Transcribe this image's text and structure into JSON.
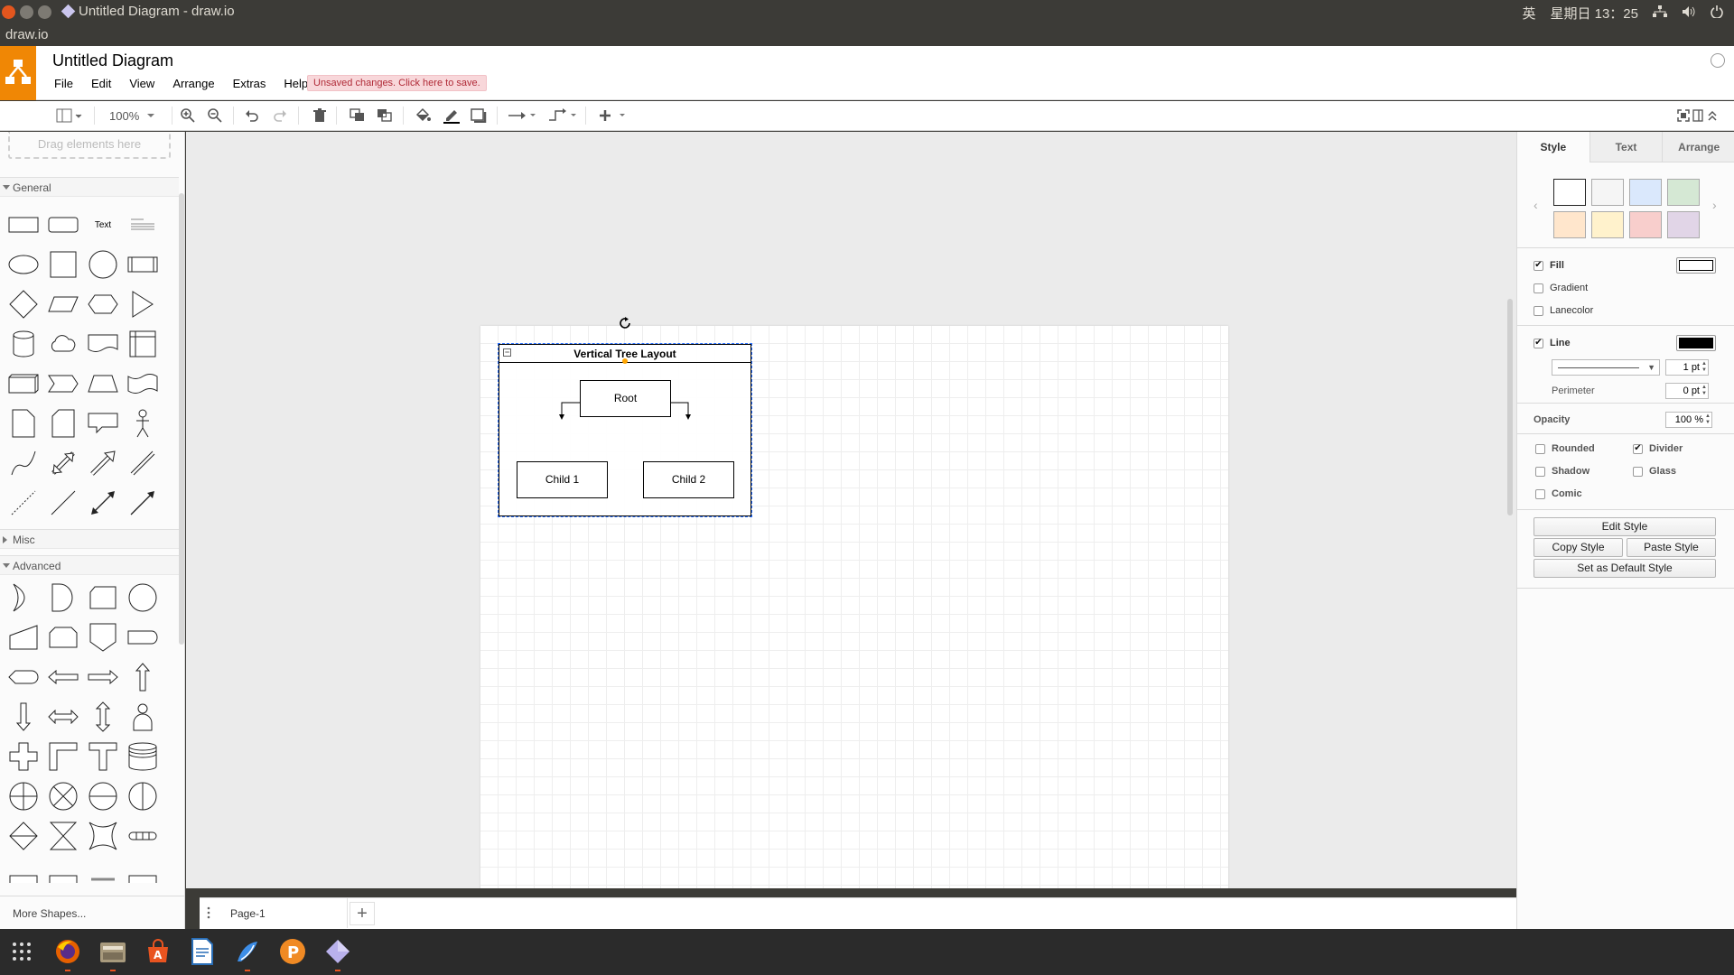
{
  "os": {
    "window_title": "Untitled Diagram - draw.io",
    "app_name": "draw.io",
    "tray": {
      "ime": "英",
      "clock": "星期日 13：25"
    }
  },
  "header": {
    "doc_title": "Untitled Diagram",
    "menu": [
      "File",
      "Edit",
      "View",
      "Arrange",
      "Extras",
      "Help"
    ],
    "unsaved": "Unsaved changes. Click here to save."
  },
  "toolbar": {
    "zoom": "100%"
  },
  "sidebar": {
    "drop_hint": "Drag elements here",
    "sections": {
      "general": "General",
      "misc": "Misc",
      "advanced": "Advanced"
    },
    "text_shape_label": "Text",
    "more_shapes": "More Shapes..."
  },
  "diagram": {
    "container_title": "Vertical Tree Layout",
    "root": "Root",
    "child1": "Child 1",
    "child2": "Child 2"
  },
  "pages": {
    "current": "Page-1"
  },
  "format_panel": {
    "tabs": [
      "Style",
      "Text",
      "Arrange"
    ],
    "swatches": [
      "#ffffff",
      "#f5f5f5",
      "#dae8fc",
      "#d5e8d4",
      "#ffe6cc",
      "#fff2cc",
      "#f8cecc",
      "#e1d5e7"
    ],
    "fill_label": "Fill",
    "fill_color": "#ffffff",
    "gradient_label": "Gradient",
    "lanecolor_label": "Lanecolor",
    "line_label": "Line",
    "line_color": "#000000",
    "line_width": "1 pt",
    "perimeter_label": "Perimeter",
    "perimeter_value": "0 pt",
    "opacity_label": "Opacity",
    "opacity_value": "100 %",
    "rounded_label": "Rounded",
    "divider_label": "Divider",
    "shadow_label": "Shadow",
    "glass_label": "Glass",
    "comic_label": "Comic",
    "edit_style": "Edit Style",
    "copy_style": "Copy Style",
    "paste_style": "Paste Style",
    "set_default": "Set as Default Style"
  }
}
